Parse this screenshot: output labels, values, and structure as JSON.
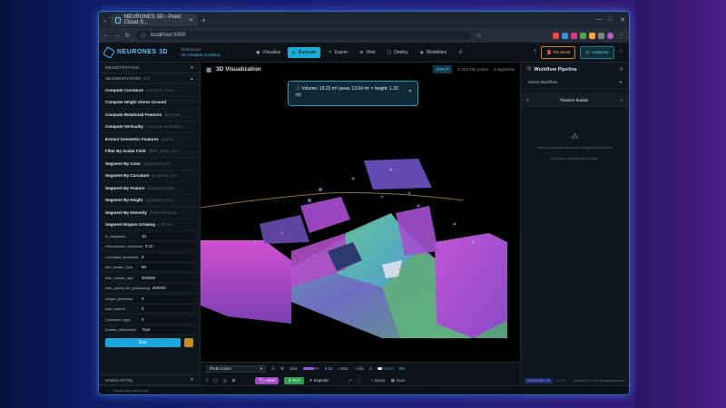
{
  "browser": {
    "tab_title": "NEURONES 3D - Point Cloud S...",
    "url": "localhost:5000"
  },
  "app": {
    "name": "NEURONES 3D",
    "workspace_label": "Workspace:",
    "workspace_name": "3D Geodata Academy",
    "nav": [
      {
        "label": "Visualize",
        "icon": "eye-icon"
      },
      {
        "label": "Execute",
        "icon": "play-icon",
        "active": true
      },
      {
        "label": "Export",
        "icon": "export-icon"
      },
      {
        "label": "Web",
        "icon": "globe-icon"
      },
      {
        "label": "Deploy",
        "icon": "deploy-icon"
      },
      {
        "label": "Modalities",
        "icon": "modalities-icon"
      }
    ],
    "book_label": "The Book",
    "academy_label": "Academy"
  },
  "sidebar": {
    "registration": "REGISTRATION",
    "segmentation": "SEGMENTATION",
    "segmentation_count": "(16)",
    "functions": [
      {
        "name": "Compute Curvature",
        "desc": "(compute curva..."
      },
      {
        "name": "Compute Height Above Ground",
        "desc": ""
      },
      {
        "name": "Compute Relational Features",
        "desc": "(Comput..."
      },
      {
        "name": "Compute Verticality",
        "desc": "(compute verticality f..."
      },
      {
        "name": "Extract Geometric Features",
        "desc": "(extrac..."
      },
      {
        "name": "Filter By Scalar Field",
        "desc": "(filter_point_clou..."
      },
      {
        "name": "Segment By Color",
        "desc": "(segment point..."
      },
      {
        "name": "Segment By Curvature",
        "desc": "(segment_poi..."
      },
      {
        "name": "Segment By Feature",
        "desc": "(segment point..."
      },
      {
        "name": "Segment By Height",
        "desc": "(segment point..."
      },
      {
        "name": "Segment By Intensity",
        "desc": "(segment point..."
      },
      {
        "name": "Segment Region Growing",
        "desc": "(cell nor..."
      }
    ],
    "params": [
      {
        "name": "K_neighbors",
        "value": "10"
      },
      {
        "name": "Smoothness_threshold",
        "value": "0.15"
      },
      {
        "name": "Curvature_threshold",
        "value": "0"
      },
      {
        "name": "Min_cluster_size",
        "value": "50"
      },
      {
        "name": "Max_cluster_size",
        "value": "500000"
      },
      {
        "name": "Max_points_for_processing",
        "value": "300000"
      },
      {
        "name": "Height_threshold",
        "value": "0"
      },
      {
        "name": "Max_search",
        "value": "0"
      },
      {
        "name": "Curvature_type",
        "value": "0"
      },
      {
        "name": "Enable_refinement",
        "value": "True"
      }
    ],
    "run_label": "Run",
    "simulation": "SIMULATION"
  },
  "viewer": {
    "title": "3D Visualization",
    "input_tag": "INPUT",
    "points": "1,423,720 points",
    "segments": "0 segments",
    "tooltip_line1": "Volume: 19.22 m³ (area: 13.54 m² × height: 1.20",
    "tooltip_line2": "m)",
    "color_mode": "RGB Colors",
    "size_label": "Size",
    "size_value": "4.23",
    "edl_label": "EDL",
    "clip_label": "Clip",
    "axis_label": "Z",
    "clip_value": "0%",
    "label_btn": "Label",
    "ply_btn": "PLY",
    "explode_btn": "Explode",
    "query_btn": "Query",
    "view_btn": "View"
  },
  "right_panel": {
    "title": "Workflow Pipeline",
    "select_workflow": "Select Workflow",
    "builder": "Pipeline Builder",
    "empty_text": "Select a workflow above or drag functions here",
    "empty_sub": "functions will execute in order",
    "badge": "NEURONES 3D",
    "version": "v1.0.0",
    "powered": "Developed for 3D Geodata Academy"
  },
  "status": {
    "text": "Visualizing sample.ply"
  }
}
